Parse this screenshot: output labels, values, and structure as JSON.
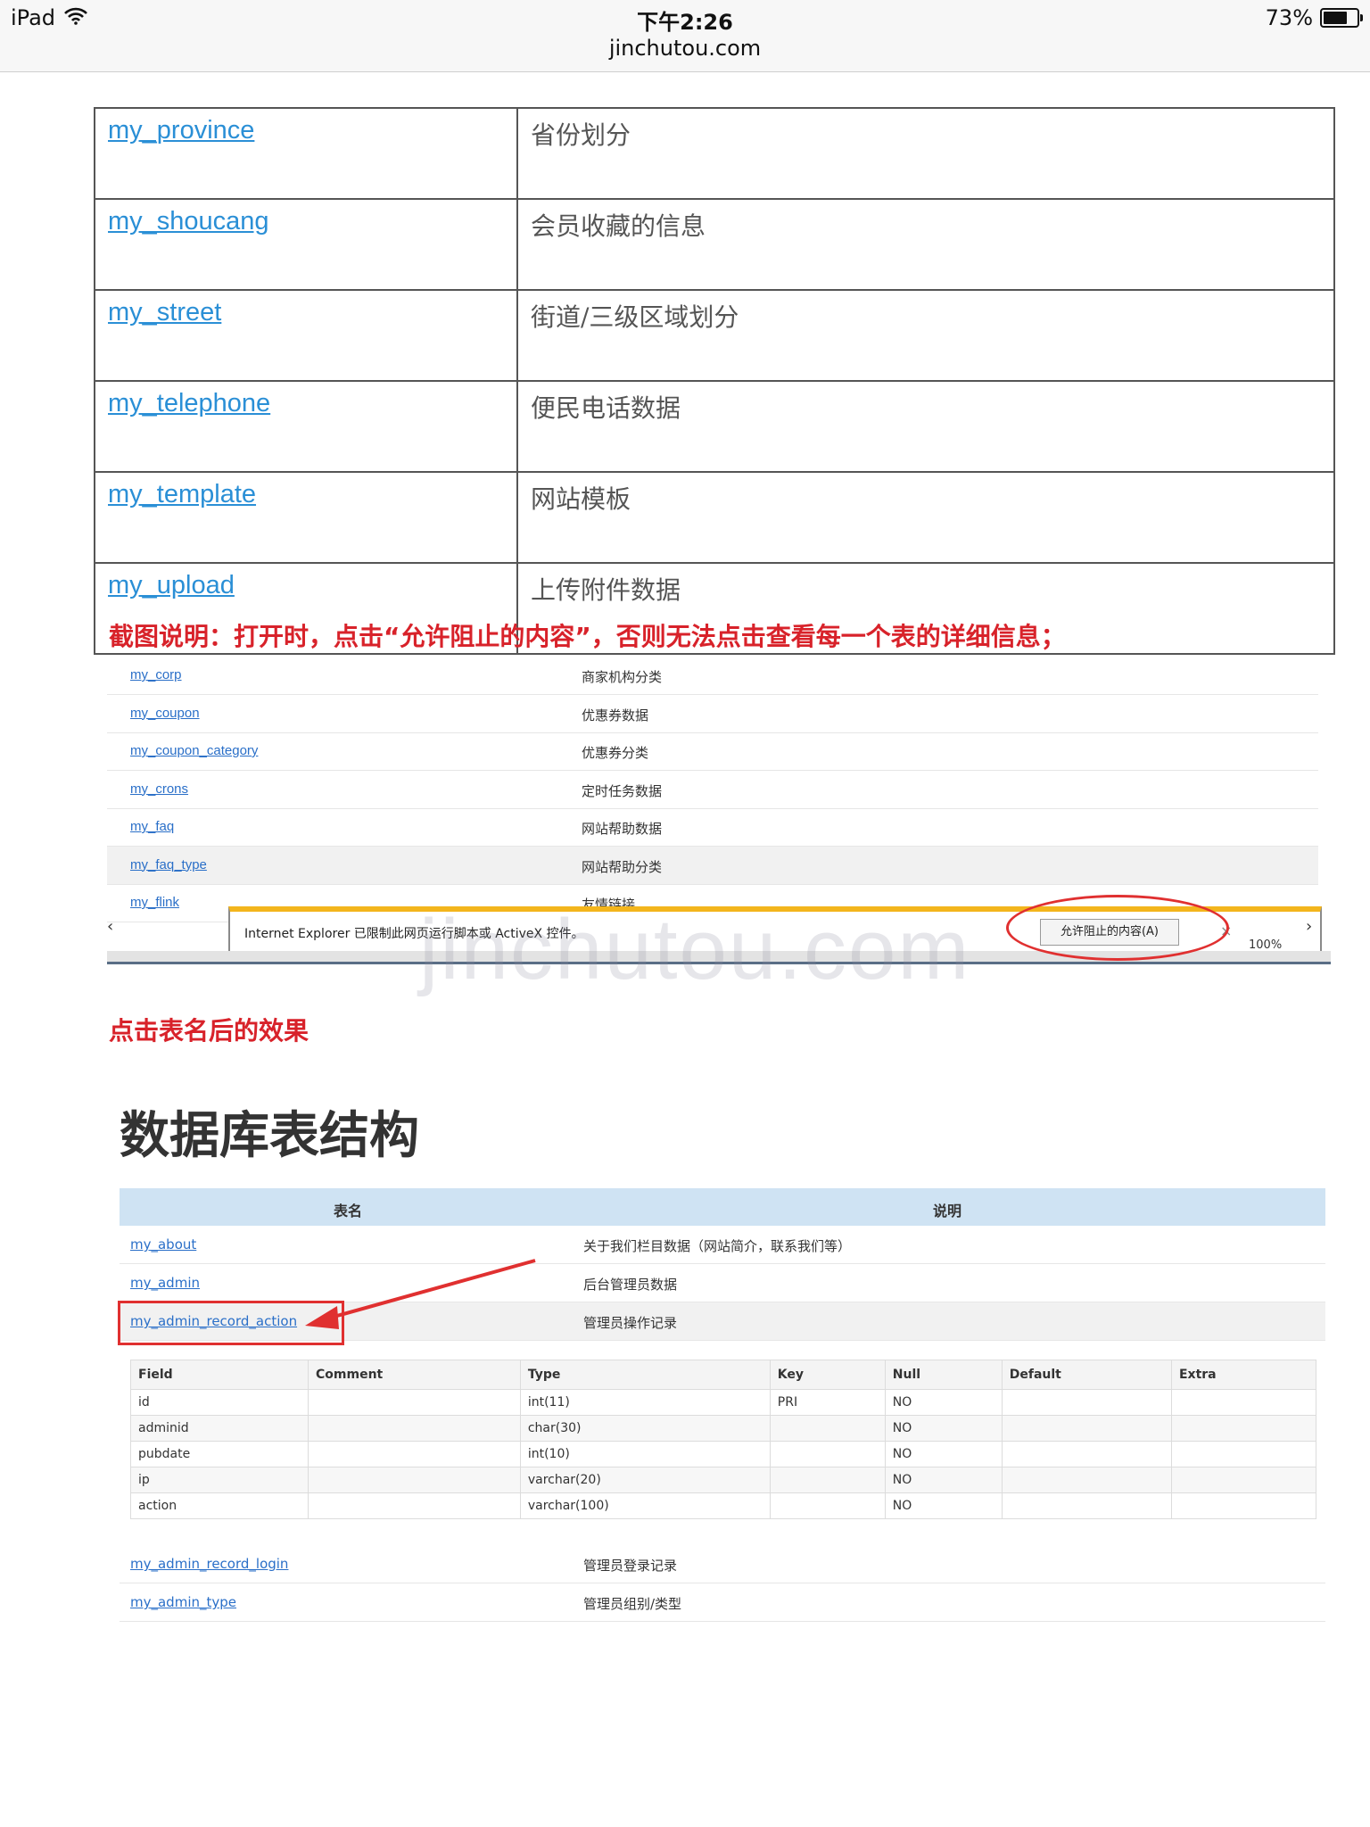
{
  "status_bar": {
    "device": "iPad",
    "time": "下午2:26",
    "url": "jinchutou.com",
    "battery": "73%",
    "battery_level": 0.73
  },
  "top_table": [
    {
      "name": "my_province",
      "desc": "省份划分"
    },
    {
      "name": "my_shoucang",
      "desc": "会员收藏的信息"
    },
    {
      "name": "my_street",
      "desc": "街道/三级区域划分"
    },
    {
      "name": "my_telephone",
      "desc": "便民电话数据"
    },
    {
      "name": "my_template",
      "desc": "网站模板"
    },
    {
      "name": "my_upload",
      "desc": "上传附件数据"
    }
  ],
  "caption1": "截图说明：打开时，点击“允许阻止的内容”，否则无法点击查看每一个表的详细信息；",
  "shot1": {
    "rows": [
      {
        "name": "my_corp",
        "desc": "商家机构分类"
      },
      {
        "name": "my_coupon",
        "desc": "优惠券数据"
      },
      {
        "name": "my_coupon_category",
        "desc": "优惠券分类"
      },
      {
        "name": "my_crons",
        "desc": "定时任务数据"
      },
      {
        "name": "my_faq",
        "desc": "网站帮助数据"
      },
      {
        "name": "my_faq_type",
        "desc": "网站帮助分类"
      },
      {
        "name": "my_flink",
        "desc": "友情链接"
      }
    ],
    "ie_message": "Internet Explorer 已限制此网页运行脚本或 ActiveX 控件。",
    "allow_button": "允许阻止的内容(A)",
    "close": "×",
    "zoom": "100%"
  },
  "watermark": "jinchutou.com",
  "caption2": "点击表名后的效果",
  "db_title": "数据库表结构",
  "shot2": {
    "head": {
      "name": "表名",
      "desc": "说明"
    },
    "rows_top": [
      {
        "name": "my_about",
        "desc": "关于我们栏目数据（网站简介，联系我们等）"
      },
      {
        "name": "my_admin",
        "desc": "后台管理员数据"
      },
      {
        "name": "my_admin_record_action",
        "desc": "管理员操作记录"
      }
    ],
    "field_headers": [
      "Field",
      "Comment",
      "Type",
      "Key",
      "Null",
      "Default",
      "Extra"
    ],
    "fields": [
      [
        "id",
        "",
        "int(11)",
        "PRI",
        "NO",
        "",
        ""
      ],
      [
        "adminid",
        "",
        "char(30)",
        "",
        "NO",
        "",
        ""
      ],
      [
        "pubdate",
        "",
        "int(10)",
        "",
        "NO",
        "",
        ""
      ],
      [
        "ip",
        "",
        "varchar(20)",
        "",
        "NO",
        "",
        ""
      ],
      [
        "action",
        "",
        "varchar(100)",
        "",
        "NO",
        "",
        ""
      ]
    ],
    "rows_bottom": [
      {
        "name": "my_admin_record_login",
        "desc": "管理员登录记录"
      },
      {
        "name": "my_admin_type",
        "desc": "管理员组别/类型"
      }
    ]
  },
  "colors": {
    "link": "#2a8fd6",
    "annotation_red": "#d8222a",
    "header_blue": "#cfe3f3",
    "ie_bar": "#f3b51c"
  }
}
